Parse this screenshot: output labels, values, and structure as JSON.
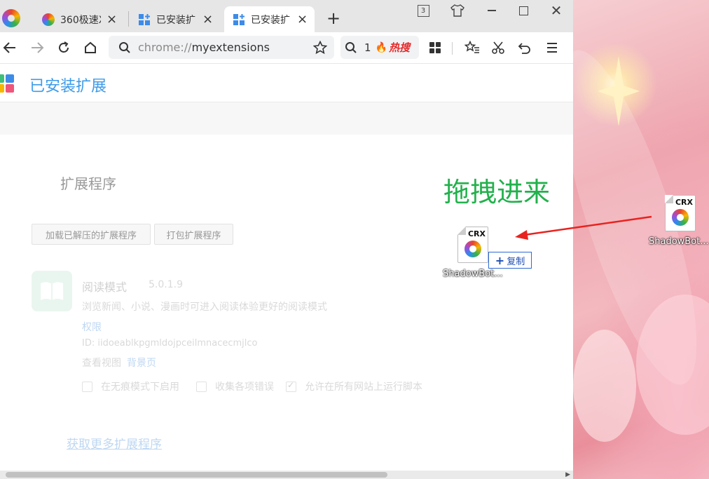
{
  "tabs": [
    {
      "title": "360极速X",
      "icon": "360-browser-icon"
    },
    {
      "title": "已安装扩",
      "icon": "extensions-icon"
    },
    {
      "title": "已安装扩",
      "icon": "extensions-icon",
      "active": true
    }
  ],
  "tab_count": "3",
  "address_bar": {
    "scheme": "chrome://",
    "host": "myextensions"
  },
  "search_box": {
    "count": "1",
    "hot_label": "热搜"
  },
  "page": {
    "title": "已安装扩展",
    "section_title": "扩展程序",
    "buttons": {
      "load_unpacked": "加载已解压的扩展程序",
      "pack": "打包扩展程序"
    },
    "extension": {
      "name": "阅读模式",
      "version": "5.0.1.9",
      "description": "浏览新闻、小说、漫画时可进入阅读体验更好的阅读模式",
      "permissions_label": "权限",
      "id_text": "ID: iidoeablkpgmldojpceilmnacecmjlco",
      "views_label": "查看视图",
      "background_page": "背景页",
      "options": [
        {
          "label": "在无痕模式下启用",
          "checked": false
        },
        {
          "label": "收集各项错误",
          "checked": false
        },
        {
          "label": "允许在所有网站上运行脚本",
          "checked": true
        }
      ]
    },
    "more_link": "获取更多扩展程序"
  },
  "annotation": {
    "drag_text": "拖拽进来",
    "color": "#22b14c",
    "arrow_color": "#e8231f"
  },
  "drag_file": {
    "type_tag": "CRX",
    "name": "ShadowBot...",
    "copy_label": "复制"
  },
  "desktop_file": {
    "type_tag": "CRX",
    "name": "ShadowBot..."
  }
}
